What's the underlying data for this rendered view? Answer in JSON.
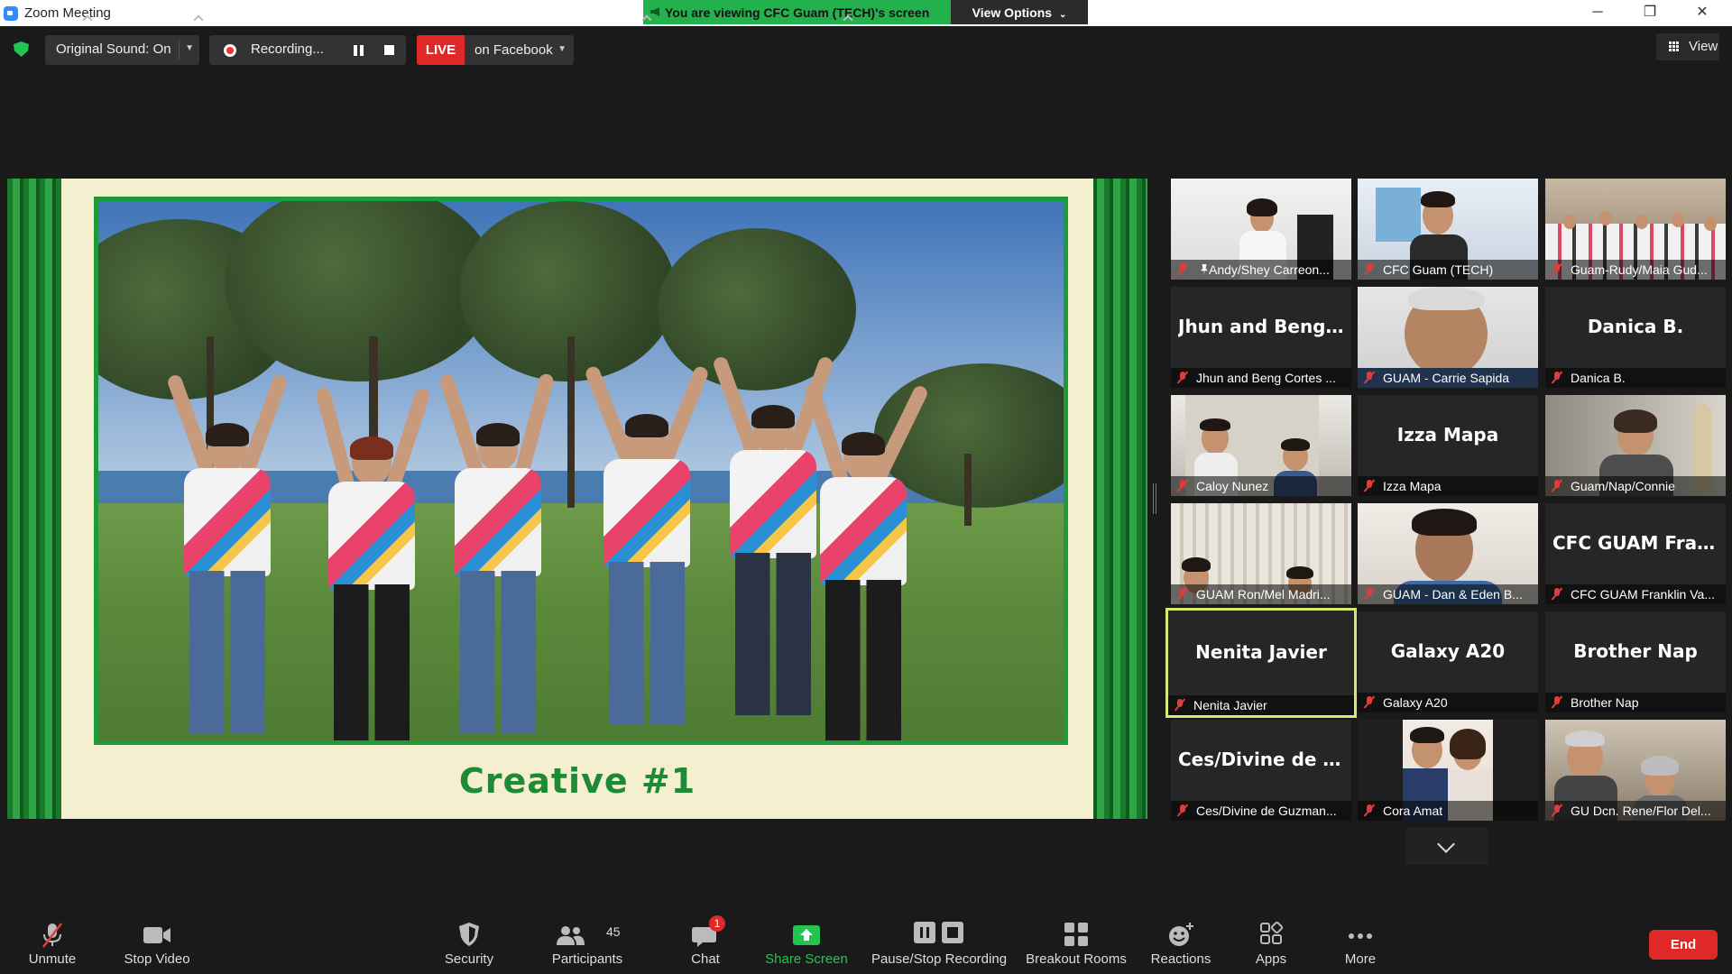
{
  "window": {
    "title": "Zoom Meeting",
    "share_banner": "You are viewing CFC Guam (TECH)'s screen",
    "view_options": "View Options",
    "min": "─",
    "max": "❐",
    "close": "✕"
  },
  "top_toolbar": {
    "original_sound": "Original Sound: On",
    "recording": "Recording...",
    "live": "LIVE",
    "live_target": "on Facebook",
    "view": "View"
  },
  "shared_screen": {
    "caption": "Creative #1"
  },
  "gallery": {
    "tiles": [
      {
        "big_name": "",
        "name": "Andy/Shey Carreon...",
        "muted": true,
        "pinned": true,
        "video": true
      },
      {
        "big_name": "",
        "name": "CFC Guam (TECH)",
        "muted": true,
        "pinned": false,
        "video": true
      },
      {
        "big_name": "",
        "name": "Guam-Rudy/Maia Gud...",
        "muted": true,
        "pinned": false,
        "video": true
      },
      {
        "big_name": "Jhun and Beng...",
        "name": "Jhun and Beng Cortes ...",
        "muted": true,
        "video": false
      },
      {
        "big_name": "",
        "name": "GUAM - Carrie Sapida",
        "muted": true,
        "video": true
      },
      {
        "big_name": "Danica B.",
        "name": "Danica B.",
        "muted": true,
        "video": false
      },
      {
        "big_name": "",
        "name": "Caloy Nunez",
        "muted": true,
        "video": true
      },
      {
        "big_name": "Izza Mapa",
        "name": "Izza Mapa",
        "muted": true,
        "video": false
      },
      {
        "big_name": "",
        "name": "Guam/Nap/Connie",
        "muted": true,
        "video": true
      },
      {
        "big_name": "",
        "name": "GUAM Ron/Mel Madri...",
        "muted": true,
        "video": true
      },
      {
        "big_name": "",
        "name": "GUAM - Dan & Eden B...",
        "muted": true,
        "video": true
      },
      {
        "big_name": "CFC GUAM Fran...",
        "name": "CFC GUAM Franklin Va...",
        "muted": true,
        "video": false
      },
      {
        "big_name": "Nenita Javier",
        "name": "Nenita Javier",
        "muted": true,
        "video": false,
        "active_speaker": true
      },
      {
        "big_name": "Galaxy A20",
        "name": "Galaxy A20",
        "muted": true,
        "video": false
      },
      {
        "big_name": "Brother Nap",
        "name": "Brother Nap",
        "muted": true,
        "video": false
      },
      {
        "big_name": "Ces/Divine de G...",
        "name": "Ces/Divine de Guzman...",
        "muted": true,
        "video": false
      },
      {
        "big_name": "",
        "name": "Cora Amat",
        "muted": true,
        "video": true
      },
      {
        "big_name": "",
        "name": "GU Dcn. Rene/Flor Del...",
        "muted": true,
        "video": true
      }
    ]
  },
  "bottom_toolbar": {
    "unmute": "Unmute",
    "stop_video": "Stop Video",
    "security": "Security",
    "participants": "Participants",
    "participants_count": "45",
    "chat": "Chat",
    "chat_badge": "1",
    "share_screen": "Share Screen",
    "pause_stop_recording": "Pause/Stop Recording",
    "breakout_rooms": "Breakout Rooms",
    "reactions": "Reactions",
    "apps": "Apps",
    "more": "More",
    "end": "End"
  },
  "colors": {
    "accent_green": "#23c552",
    "live_red": "#e02828",
    "active_speaker_border": "#d9e870",
    "muted_red": "#e03c3c"
  }
}
